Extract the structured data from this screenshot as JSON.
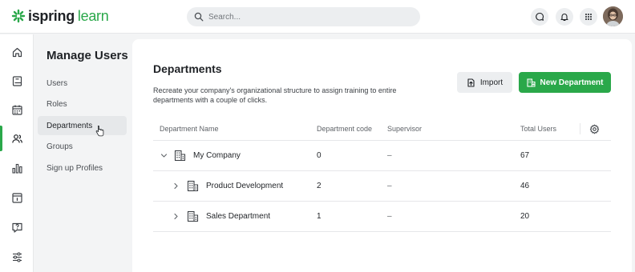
{
  "header": {
    "logo_word_1": "ispring",
    "logo_word_2": "learn",
    "search_placeholder": "Search..."
  },
  "rail": {
    "items": [
      {
        "icon": "home-icon"
      },
      {
        "icon": "book-icon"
      },
      {
        "icon": "calendar-icon"
      },
      {
        "icon": "users-icon",
        "active": true
      },
      {
        "icon": "bar-chart-icon"
      },
      {
        "icon": "info-card-icon"
      },
      {
        "icon": "question-chat-icon"
      },
      {
        "icon": "sliders-icon"
      }
    ]
  },
  "submenu": {
    "title": "Manage Users",
    "items": [
      {
        "label": "Users"
      },
      {
        "label": "Roles"
      },
      {
        "label": "Departments",
        "active": true
      },
      {
        "label": "Groups"
      },
      {
        "label": "Sign up Profiles"
      }
    ]
  },
  "main": {
    "title": "Departments",
    "description": "Recreate your company's organizational structure to assign training to entire departments with a couple of clicks.",
    "import_label": "Import",
    "new_department_label": "New Department",
    "columns": {
      "name": "Department Name",
      "code": "Department code",
      "supervisor": "Supervisor",
      "total_users": "Total Users"
    },
    "rows": [
      {
        "name": "My Company",
        "code": "0",
        "supervisor": "–",
        "total_users": "67",
        "expanded": true
      },
      {
        "name": "Product Development",
        "code": "2",
        "supervisor": "–",
        "total_users": "46",
        "expanded": false
      },
      {
        "name": "Sales Department",
        "code": "1",
        "supervisor": "–",
        "total_users": "20",
        "expanded": false
      }
    ]
  },
  "colors": {
    "accent": "#2aa84a",
    "background": "#f3f4f5",
    "panel": "#ffffff"
  }
}
